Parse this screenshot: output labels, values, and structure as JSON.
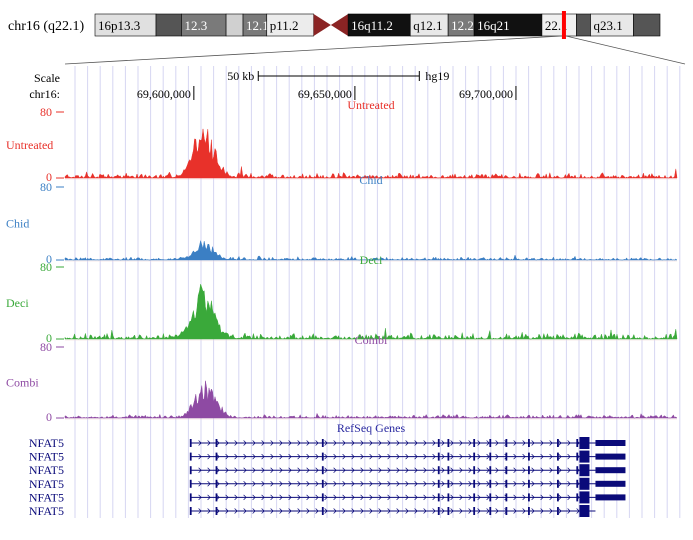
{
  "ideogram": {
    "label": "chr16 (q22.1)",
    "bands": [
      {
        "name": "16p13.3",
        "start": 0,
        "end": 0.108,
        "fill": "#e0e0e0",
        "text": "#000000"
      },
      {
        "name": "",
        "start": 0.108,
        "end": 0.153,
        "fill": "#555555",
        "text": "#ffffff"
      },
      {
        "name": "12.3",
        "start": 0.153,
        "end": 0.232,
        "fill": "#7a7a7a",
        "text": "#ffffff"
      },
      {
        "name": "",
        "start": 0.232,
        "end": 0.262,
        "fill": "#d0d0d0",
        "text": "#000000"
      },
      {
        "name": "12.1",
        "start": 0.262,
        "end": 0.304,
        "fill": "#7a7a7a",
        "text": "#ffffff"
      },
      {
        "name": "p11.2",
        "start": 0.304,
        "end": 0.387,
        "fill": "#ececec",
        "text": "#000000"
      },
      {
        "name": "",
        "start": 0.387,
        "end": 0.448,
        "fill": "#8b2424",
        "text": "#ffffff"
      },
      {
        "name": "16q11.2",
        "start": 0.448,
        "end": 0.558,
        "fill": "#111111",
        "text": "#ffffff"
      },
      {
        "name": "q12.1",
        "start": 0.558,
        "end": 0.625,
        "fill": "#e8e8e8",
        "text": "#000000"
      },
      {
        "name": "12.2",
        "start": 0.625,
        "end": 0.671,
        "fill": "#7a7a7a",
        "text": "#ffffff"
      },
      {
        "name": "16q21",
        "start": 0.671,
        "end": 0.791,
        "fill": "#111111",
        "text": "#ffffff"
      },
      {
        "name": "22.1",
        "start": 0.791,
        "end": 0.852,
        "fill": "#f0f0f0",
        "text": "#000000"
      },
      {
        "name": "",
        "start": 0.852,
        "end": 0.877,
        "fill": "#555555",
        "text": "#ffffff"
      },
      {
        "name": "q23.1",
        "start": 0.877,
        "end": 0.953,
        "fill": "#e8e8e8",
        "text": "#000000"
      },
      {
        "name": "",
        "start": 0.953,
        "end": 1.0,
        "fill": "#555555",
        "text": "#ffffff"
      }
    ],
    "highlight": 0.83,
    "highlight_color": "#ff0000"
  },
  "ruler": {
    "scale_label": "Scale",
    "scale_bar": "50 kb",
    "assembly": "hg19",
    "chrom_label": "chr16:",
    "ticks": [
      "69,600,000",
      "69,650,000",
      "69,700,000"
    ]
  },
  "chart_data": {
    "type": "area",
    "x_range": [
      69560000,
      69750000
    ],
    "ylim": [
      0,
      80
    ],
    "tick_positions": [
      69600000,
      69650000,
      69700000
    ],
    "signal_tracks": [
      {
        "name": "Untreated",
        "color": "#e8312a",
        "y_max_label": "80",
        "y_min_label": "0",
        "peak": {
          "center": 69603000,
          "height": 70,
          "width": 6500
        },
        "background": 5
      },
      {
        "name": "Chid",
        "color": "#3b7fc4",
        "y_max_label": "80",
        "y_min_label": "0",
        "peak": {
          "center": 69603000,
          "height": 21,
          "width": 6000
        },
        "background": 2.5
      },
      {
        "name": "Deci",
        "color": "#3aa93a",
        "y_max_label": "80",
        "y_min_label": "0",
        "peak": {
          "center": 69603000,
          "height": 62,
          "width": 6500
        },
        "background": 5
      },
      {
        "name": "Combi",
        "color": "#8e4aa3",
        "y_max_label": "80",
        "y_min_label": "0",
        "peak": {
          "center": 69603500,
          "height": 42,
          "width": 6500
        },
        "background": 3
      }
    ]
  },
  "genes": {
    "title": "RefSeq Genes",
    "color": "#0a0a7a",
    "track_color": "#2a2aa0",
    "start": 69599000,
    "end": 69734000,
    "rows": [
      {
        "label": "NFAT5",
        "exons": [
          69599000,
          69607000,
          69640000,
          69676000,
          69679000,
          69687000,
          69692000,
          69697000,
          69704000,
          69713000,
          69719000
        ]
      },
      {
        "label": "NFAT5",
        "exons": [
          69599000,
          69607000,
          69640000,
          69676000,
          69679000,
          69687000,
          69692000,
          69697000,
          69704000,
          69713000,
          69719000
        ]
      },
      {
        "label": "NFAT5",
        "exons": [
          69599000,
          69607000,
          69640000,
          69676000,
          69679000,
          69687000,
          69692000,
          69697000,
          69704000,
          69713000,
          69719000
        ]
      },
      {
        "label": "NFAT5",
        "exons": [
          69599000,
          69607000,
          69640000,
          69676000,
          69679000,
          69687000,
          69692000,
          69697000,
          69704000,
          69713000,
          69719000
        ]
      },
      {
        "label": "NFAT5",
        "exons": [
          69599000,
          69607000,
          69640000,
          69676000,
          69679000,
          69687000,
          69692000,
          69697000,
          69704000,
          69713000,
          69719000
        ]
      },
      {
        "label": "NFAT5",
        "exons": [
          69599000,
          69607000,
          69640000,
          69676000,
          69679000,
          69687000,
          69692000,
          69697000,
          69704000,
          69713000
        ]
      }
    ]
  }
}
